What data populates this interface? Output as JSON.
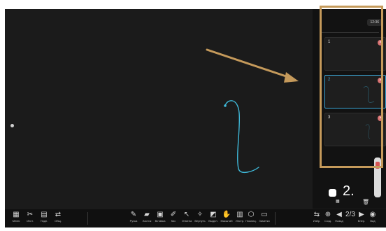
{
  "status": {
    "clock": "12:36"
  },
  "canvas": {
    "ink_color": "#3fb8d8",
    "edge_left_icon": "left-nav-dot-icon",
    "edge_right_icon": "right-nav-dot-icon"
  },
  "pages": [
    {
      "number": "1",
      "active": false
    },
    {
      "number": "2",
      "active": true
    },
    {
      "number": "3",
      "active": false
    }
  ],
  "page_indicator": {
    "current": "2."
  },
  "annotation": {
    "color": "#c59a5b"
  },
  "toolbar": {
    "left": [
      {
        "icon": "menu-icon",
        "glyph": "▦",
        "label": "Меню"
      },
      {
        "icon": "tools-icon",
        "glyph": "✂",
        "label": "Инст."
      },
      {
        "icon": "gallery-icon",
        "glyph": "▤",
        "label": "Подп."
      },
      {
        "icon": "share-icon",
        "glyph": "⇄",
        "label": "Общ."
      }
    ],
    "center": [
      {
        "icon": "pen-icon",
        "glyph": "✎",
        "label": "Ручка"
      },
      {
        "icon": "eraser-icon",
        "glyph": "▰",
        "label": "Ластик"
      },
      {
        "icon": "insert-icon",
        "glyph": "▣",
        "label": "Вставка"
      },
      {
        "icon": "fill-icon",
        "glyph": "✐",
        "label": "Кис"
      },
      {
        "icon": "select-icon",
        "glyph": "↖",
        "label": "Отмена"
      },
      {
        "icon": "laser-icon",
        "glyph": "✧",
        "label": "Вернуть"
      },
      {
        "icon": "frame-icon",
        "glyph": "◩",
        "label": "Выдел."
      },
      {
        "icon": "hand-icon",
        "glyph": "✋",
        "label": "Масштаб"
      },
      {
        "icon": "apps-icon",
        "glyph": "▥",
        "label": "Инстр."
      }
    ],
    "center2": [
      {
        "icon": "lasso-icon",
        "glyph": "⬡",
        "label": "Ножниц."
      },
      {
        "icon": "notes-icon",
        "glyph": "▭",
        "label": "Заметки"
      }
    ],
    "right": [
      {
        "icon": "switch-icon",
        "glyph": "⇆",
        "label": "Избр."
      },
      {
        "icon": "add-page-icon",
        "glyph": "⊕",
        "label": "Созд."
      },
      {
        "icon": "prev-page-icon",
        "glyph": "◀",
        "label": "Назад"
      },
      {
        "icon": "page-counter-icon",
        "glyph": "2/3",
        "label": ""
      },
      {
        "icon": "next-page-icon",
        "glyph": "▶",
        "label": "Впер."
      },
      {
        "icon": "more-icon",
        "glyph": "◉",
        "label": "Вид"
      }
    ]
  }
}
